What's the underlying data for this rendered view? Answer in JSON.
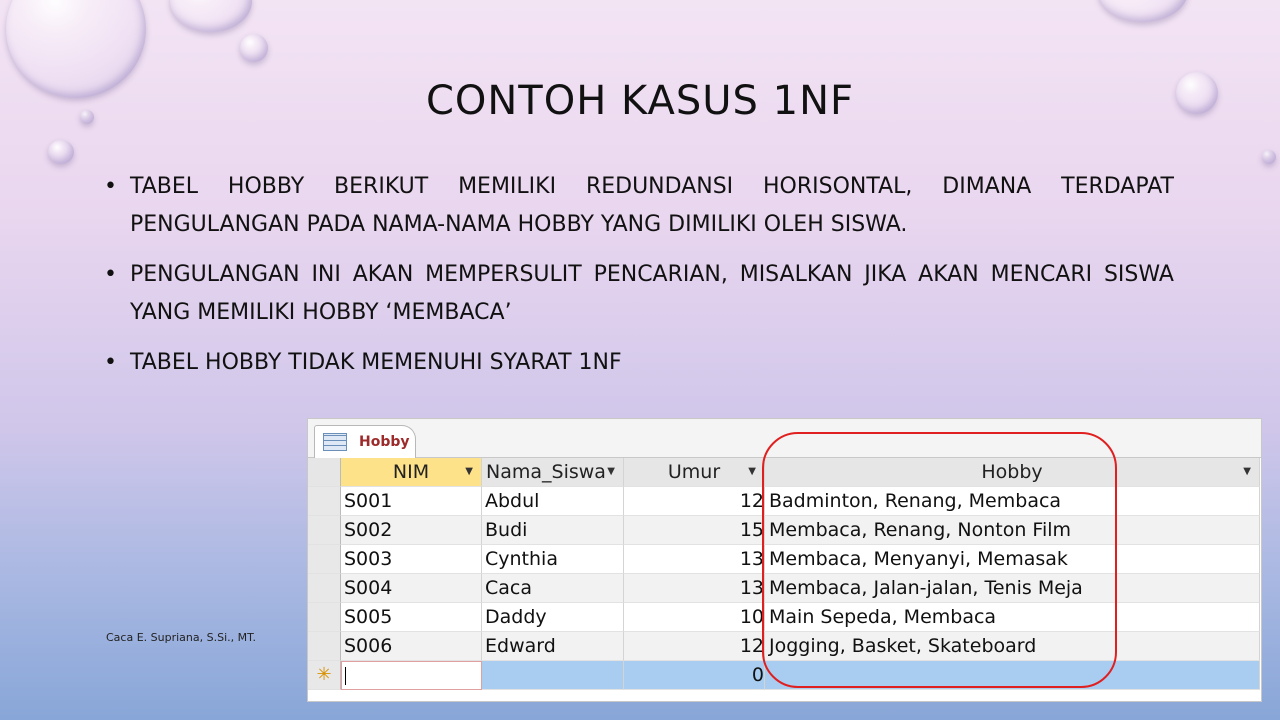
{
  "slide": {
    "title": "Contoh Kasus 1NF",
    "bullets": [
      "Tabel Hobby berikut memiliki redundansi horisontal, dimana terdapat pengulangan pada nama-nama hobby yang dimiliki oleh siswa.",
      "Pengulangan ini akan mempersulit pencarian, misalkan jika akan mencari siswa yang memiliki hobby ‘membaca’",
      "Tabel Hobby tidak memenuhi syarat 1NF"
    ],
    "author": "Caca E. Supriana, S.Si., MT."
  },
  "table_window": {
    "tab_label": "Hobby",
    "tab_icon": "table-icon",
    "columns": [
      "NIM",
      "Nama_Siswa",
      "Umur",
      "Hobby"
    ],
    "rows": [
      {
        "nim": "S001",
        "nama": "Abdul",
        "umur": "12",
        "hobby": "Badminton, Renang, Membaca"
      },
      {
        "nim": "S002",
        "nama": "Budi",
        "umur": "15",
        "hobby": "Membaca, Renang, Nonton Film"
      },
      {
        "nim": "S003",
        "nama": "Cynthia",
        "umur": "13",
        "hobby": "Membaca, Menyanyi, Memasak"
      },
      {
        "nim": "S004",
        "nama": "Caca",
        "umur": "13",
        "hobby": "Membaca, Jalan-jalan, Tenis Meja"
      },
      {
        "nim": "S005",
        "nama": "Daddy",
        "umur": "10",
        "hobby": "Main Sepeda, Membaca"
      },
      {
        "nim": "S006",
        "nama": "Edward",
        "umur": "12",
        "hobby": "Jogging, Basket, Skateboard"
      }
    ],
    "new_row": {
      "marker": "✳",
      "umur_default": "0"
    },
    "highlight_color": "#e02020",
    "header_active_color": "#fde28a",
    "new_row_color": "#a9cdf0"
  }
}
